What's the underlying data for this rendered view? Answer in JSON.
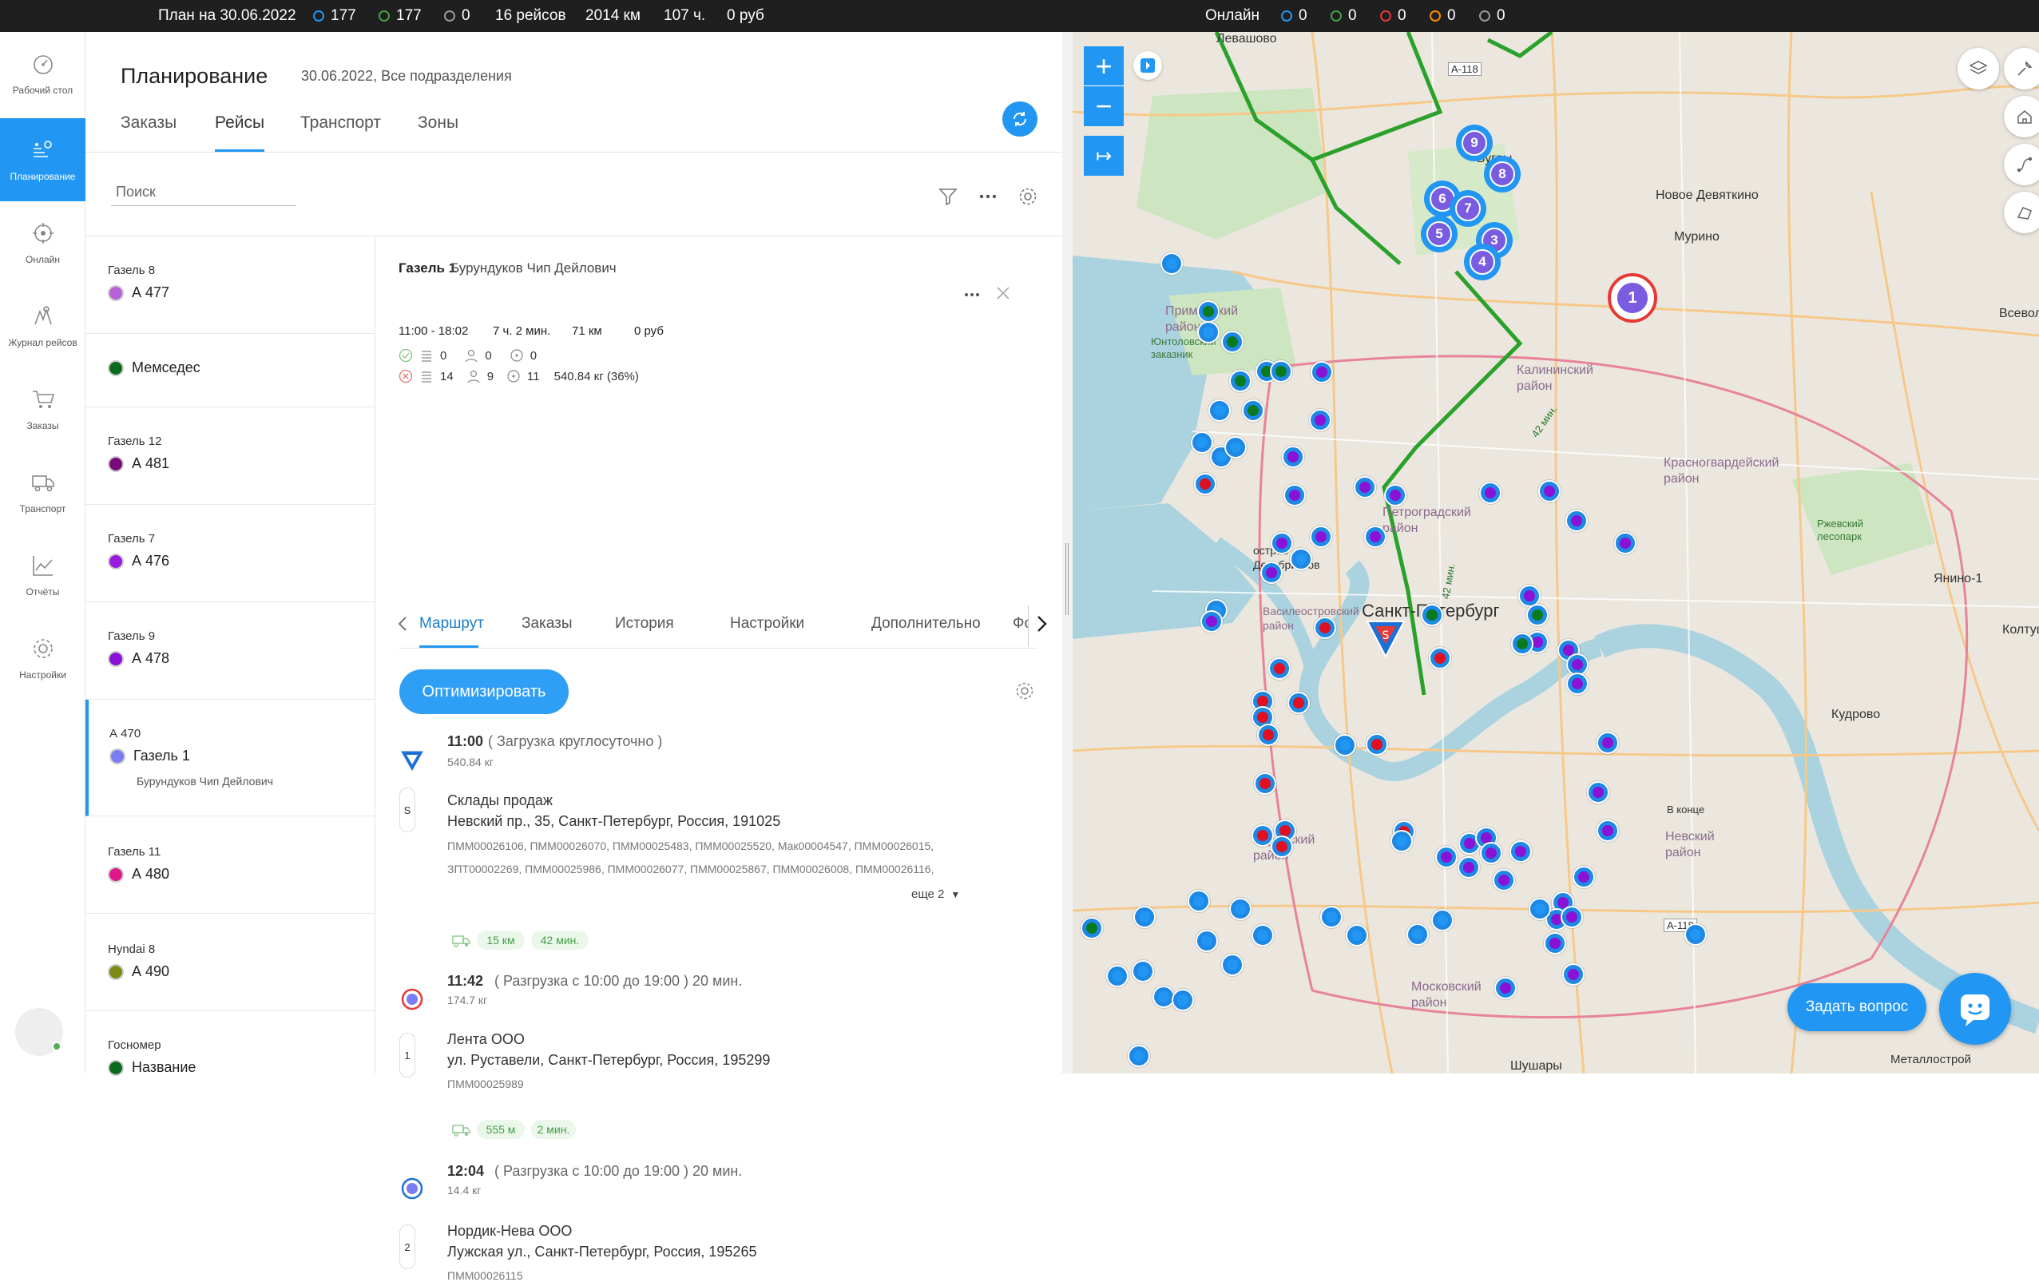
{
  "topbar": {
    "plan_label": "План на 30.06.2022",
    "count_blue": "177",
    "count_green": "177",
    "count_gray": "0",
    "trips": "16 рейсов",
    "distance": "2014 км",
    "hours": "107 ч.",
    "cost": "0 руб",
    "online_label": "Онлайн",
    "online_blue": "0",
    "online_green": "0",
    "online_red": "0",
    "online_orange": "0",
    "online_gray": "0"
  },
  "rail": {
    "items": [
      {
        "label": "Рабочий стол",
        "icon": "dashboard-icon"
      },
      {
        "label": "Планирование",
        "icon": "planning-icon"
      },
      {
        "label": "Онлайн",
        "icon": "online-icon"
      },
      {
        "label": "Журнал рейсов",
        "icon": "journal-icon"
      },
      {
        "label": "Заказы",
        "icon": "cart-icon"
      },
      {
        "label": "Транспорт",
        "icon": "truck-icon"
      },
      {
        "label": "Отчёты",
        "icon": "reports-icon"
      },
      {
        "label": "Настройки",
        "icon": "settings-icon"
      }
    ]
  },
  "page": {
    "title": "Планирование",
    "subtitle": "30.06.2022, Все подразделения",
    "tabs": [
      "Заказы",
      "Рейсы",
      "Транспорт",
      "Зоны"
    ],
    "active_tab": "Рейсы",
    "search_placeholder": "Поиск"
  },
  "vehicles": [
    {
      "top": "Газель 8",
      "name": "А 477",
      "color": "#b562d9",
      "driver": ""
    },
    {
      "top": "",
      "name": "Мемседес",
      "color": "#0a6b1e",
      "driver": ""
    },
    {
      "top": "Газель 12",
      "name": "А 481",
      "color": "#7a0a7a",
      "driver": ""
    },
    {
      "top": "Газель 7",
      "name": "А 476",
      "color": "#9a1ae0",
      "driver": ""
    },
    {
      "top": "Газель 9",
      "name": "А 478",
      "color": "#8a10d8",
      "driver": ""
    },
    {
      "top": "А 470",
      "name": "Газель 1",
      "color": "#7a7cf0",
      "driver": "Бурундуков Чип Дейлович"
    },
    {
      "top": "Газель 11",
      "name": "А 480",
      "color": "#e0168a",
      "driver": ""
    },
    {
      "top": "Hyndai 8",
      "name": "А 490",
      "color": "#7f8a12",
      "driver": ""
    },
    {
      "top": "Госномер",
      "name": "Название",
      "color": "#0a6b1e",
      "driver": ""
    }
  ],
  "trip": {
    "vehicle": "Газель 1",
    "driver": "Бурундуков Чип Дейлович",
    "time_range": "11:00 - 18:02",
    "duration": "7 ч. 2 мин.",
    "distance": "71 км",
    "cost": "0 руб",
    "done_orders": "0",
    "done_people": "0",
    "done_points": "0",
    "fail_orders": "14",
    "fail_people": "9",
    "fail_points": "11",
    "load": "540.84 кг (36%)",
    "tabs": [
      "Маршрут",
      "Заказы",
      "История",
      "Настройки",
      "Дополнительно",
      "Фо"
    ],
    "active_tab": "Маршрут",
    "optimize_label": "Оптимизировать"
  },
  "route": {
    "depot": {
      "time": "11:00",
      "note": "( Загрузка круглосуточно )",
      "weight": "540.84 кг"
    },
    "stops": [
      {
        "badge": "S",
        "name": "Склады продаж",
        "address": "Невский пр., 35, Санкт-Петербург, Россия, 191025",
        "orders1": "ПММ00026106, ПММ00026070, ПММ00025483, ПММ00025520, Мак00004547, ПММ00026015,",
        "orders2": "ЗПТ00002269, ПММ00025986, ПММ00026077, ПММ00025867, ПММ00026008, ПММ00026116,",
        "more": "еще 2"
      },
      {
        "badge": "1",
        "time": "11:42",
        "note": "( Разгрузка с 10:00 до 19:00 ) 20 мин.",
        "weight": "174.7 кг",
        "name": "Лента ООО",
        "address": "ул. Руставели, Санкт-Петербург, Россия, 195299",
        "orders1": "ПММ00025989"
      },
      {
        "badge": "2",
        "time": "12:04",
        "note": "( Разгрузка с 10:00 до 19:00 ) 20 мин.",
        "weight": "14.4 кг",
        "name": "Нордик-Нева ООО",
        "address": "Лужская ул., Санкт-Петербург, Россия, 195265",
        "orders1": "ПММ00026115"
      }
    ],
    "legs": [
      {
        "dist": "15 км",
        "time": "42 мин."
      },
      {
        "dist": "555 м",
        "time": "2 мин."
      }
    ]
  },
  "map": {
    "labels": [
      "Левашово",
      "Бугры",
      "Новое Девяткино",
      "Мурино",
      "Всеволож",
      "Приморский район",
      "Юнтоловский заказник",
      "Калининский район",
      "Красногвардейский район",
      "Ржевский лесопарк",
      "Янино-1",
      "Петроградский район",
      "остров Декабристов",
      "Василеостровский район",
      "Санкт-Петербург",
      "Колтуш",
      "Кудрово",
      "Кировский район",
      "Невский район",
      "Московский район",
      "Шушары",
      "Металлострой",
      "А-118",
      "А-118",
      "42 мин.",
      "42 мин.",
      "В конце"
    ],
    "cluster_numbers": [
      "9",
      "8",
      "6",
      "7",
      "5",
      "3",
      "4",
      "1"
    ],
    "ask_label": "Задать вопрос",
    "colors": {
      "route": "#2aa12a",
      "blue_pin": "#2196f3",
      "purple_pin": "#8a12d6",
      "red_pin": "#e01020",
      "green_pin": "#0a7a1e"
    }
  }
}
